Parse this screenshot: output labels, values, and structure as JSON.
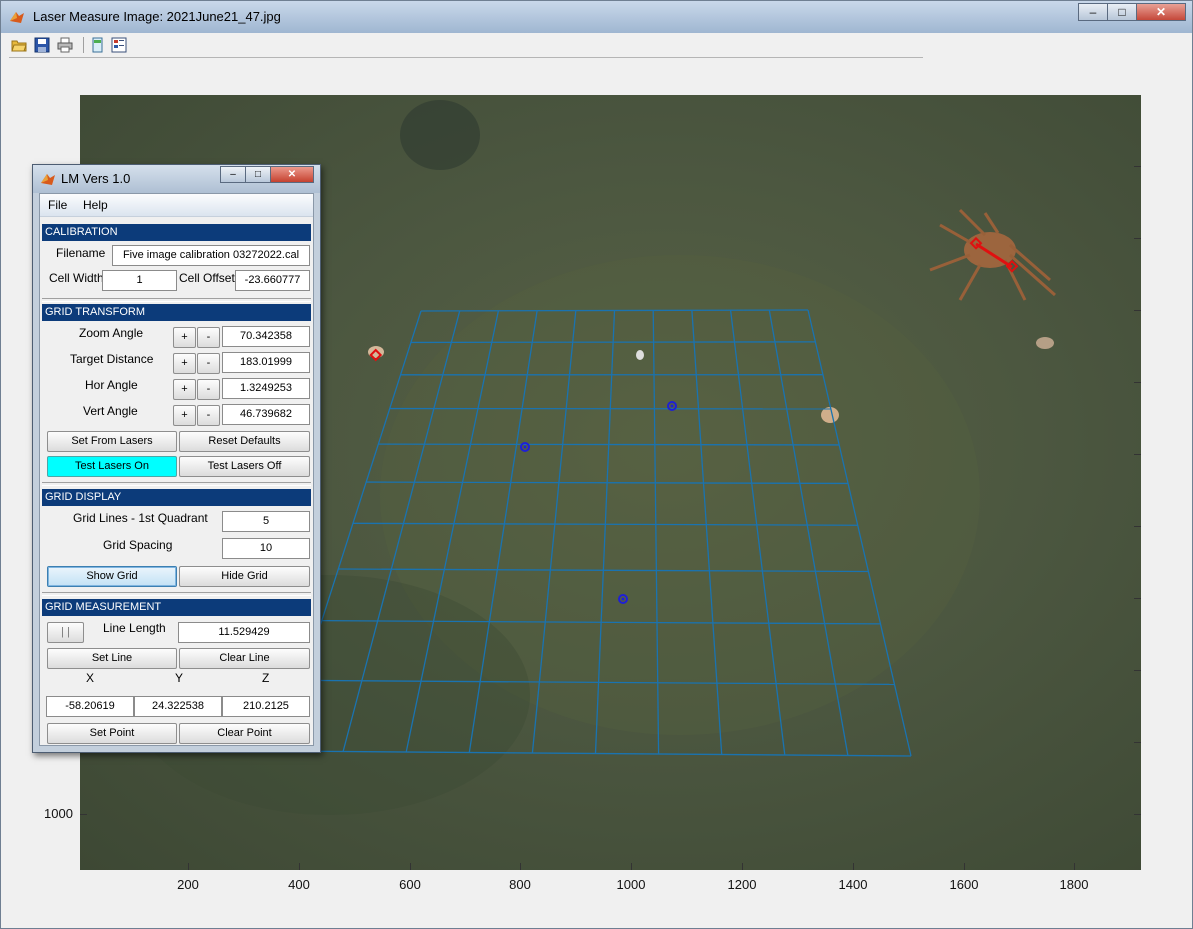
{
  "main_window": {
    "title": "Laser Measure Image:  2021June21_47.jpg",
    "controls": {
      "minimize": "–",
      "maximize": "□",
      "close": "✕"
    }
  },
  "toolbar": {
    "icons": [
      "open-folder-icon",
      "save-icon",
      "print-icon",
      "panel-icon",
      "data-table-icon"
    ]
  },
  "plot": {
    "x_ticks": [
      "200",
      "400",
      "600",
      "800",
      "1000",
      "1200",
      "1400",
      "1600",
      "1800"
    ],
    "y_ticks": [
      "1000"
    ]
  },
  "panel": {
    "title": "LM Vers 1.0",
    "controls": {
      "minimize": "–",
      "maximize": "□",
      "close": "✕"
    },
    "menu": {
      "file": "File",
      "help": "Help"
    },
    "calibration": {
      "header": "CALIBRATION",
      "filename_label": "Filename",
      "filename_value": "Five image calibration  03272022.cal",
      "cell_width_label": "Cell Width",
      "cell_width_value": "1",
      "cell_offset_label": "Cell Offset",
      "cell_offset_value": "-23.660777"
    },
    "grid_transform": {
      "header": "GRID TRANSFORM",
      "plus": "+",
      "minus": "-",
      "rows": [
        {
          "label": "Zoom Angle",
          "value": "70.342358"
        },
        {
          "label": "Target Distance",
          "value": "183.01999"
        },
        {
          "label": "Hor Angle",
          "value": "1.3249253"
        },
        {
          "label": "Vert Angle",
          "value": "46.739682"
        }
      ],
      "set_from_lasers": "Set From Lasers",
      "reset_defaults": "Reset Defaults",
      "test_lasers_on": "Test Lasers On",
      "test_lasers_off": "Test Lasers Off"
    },
    "grid_display": {
      "header": "GRID DISPLAY",
      "grid_lines_label": "Grid Lines - 1st Quadrant",
      "grid_lines_value": "5",
      "grid_spacing_label": "Grid Spacing",
      "grid_spacing_value": "10",
      "show_grid": "Show Grid",
      "hide_grid": "Hide Grid"
    },
    "grid_measurement": {
      "header": "GRID MEASUREMENT",
      "pause_label": "| |",
      "line_length_label": "Line Length",
      "line_length_value": "11.529429",
      "set_line": "Set Line",
      "clear_line": "Clear Line",
      "x_label": "X",
      "y_label": "Y",
      "z_label": "Z",
      "x_value": "-58.20619",
      "y_value": "24.322538",
      "z_value": "210.2125",
      "set_point": "Set Point",
      "clear_point": "Clear Point"
    }
  },
  "colors": {
    "section_header": "#0c3b7a",
    "grid_line": "#1a73b0",
    "laser_marker": "#1f1fd6",
    "measure_line": "#e01010",
    "test_lasers_on_bg": "#00ffff"
  }
}
